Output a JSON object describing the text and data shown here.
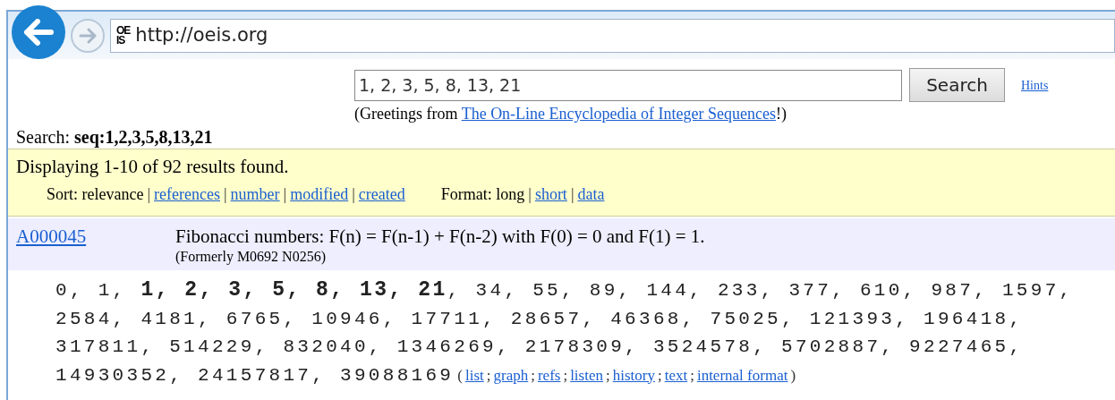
{
  "browser": {
    "back_disabled": false,
    "forward_disabled": true,
    "favicon": [
      "OE",
      "IS"
    ],
    "url": "http://oeis.org"
  },
  "search": {
    "value": "1, 2, 3, 5, 8, 13, 21",
    "button": "Search",
    "hints": "Hints",
    "greeting": [
      {
        "kind": "text",
        "text": "(Greetings from "
      },
      {
        "kind": "link",
        "text": "The On-Line Encyclopedia of Integer Sequences"
      },
      {
        "kind": "text",
        "text": "!)"
      }
    ]
  },
  "query": "Search: **seq:1,2,3,5,8,13,21**",
  "results_bar": {
    "summary": "Displaying 1-10 of 92 results found.",
    "sort": [
      {
        "kind": "text",
        "text": "Sort: relevance"
      },
      {
        "kind": "sep",
        "text": "|"
      },
      {
        "kind": "link",
        "text": "references"
      },
      {
        "kind": "sep",
        "text": "|"
      },
      {
        "kind": "link",
        "text": "number"
      },
      {
        "kind": "sep",
        "text": "|"
      },
      {
        "kind": "link",
        "text": "modified"
      },
      {
        "kind": "sep",
        "text": "|"
      },
      {
        "kind": "link",
        "text": "created"
      }
    ],
    "format": [
      {
        "kind": "text",
        "text": "Format: long"
      },
      {
        "kind": "sep",
        "text": "|"
      },
      {
        "kind": "link",
        "text": "short"
      },
      {
        "kind": "sep",
        "text": "|"
      },
      {
        "kind": "link",
        "text": "data"
      }
    ]
  },
  "result": {
    "id": "A000045",
    "name": "Fibonacci numbers: F(n) = F(n-1) + F(n-2) with F(0) = 0 and F(1) = 1.",
    "formerly": "(Formerly M0692 N0256)",
    "terms": [
      "0, 1, **1, 2, 3, 5, 8, 13, 21**, 34, 55, 89, 144, 233, 377, 610, 987, 1597,",
      "2584, 4181, 6765, 10946, 17711, 28657, 46368, 75025, 121393, 196418,",
      "317811, 514229, 832040, 1346269, 2178309, 3524578, 5702887, 9227465,",
      "14930352, 24157817, 39088169"
    ],
    "links": [
      {
        "kind": "sep",
        "text": "("
      },
      {
        "kind": "link",
        "text": "list"
      },
      {
        "kind": "sep",
        "text": ";"
      },
      {
        "kind": "link",
        "text": "graph"
      },
      {
        "kind": "sep",
        "text": ";"
      },
      {
        "kind": "link",
        "text": "refs"
      },
      {
        "kind": "sep",
        "text": ";"
      },
      {
        "kind": "link",
        "text": "listen"
      },
      {
        "kind": "sep",
        "text": ";"
      },
      {
        "kind": "link",
        "text": "history"
      },
      {
        "kind": "sep",
        "text": ";"
      },
      {
        "kind": "link",
        "text": "text"
      },
      {
        "kind": "sep",
        "text": ";"
      },
      {
        "kind": "link",
        "text": "internal format"
      },
      {
        "kind": "sep",
        "text": ")"
      }
    ]
  }
}
